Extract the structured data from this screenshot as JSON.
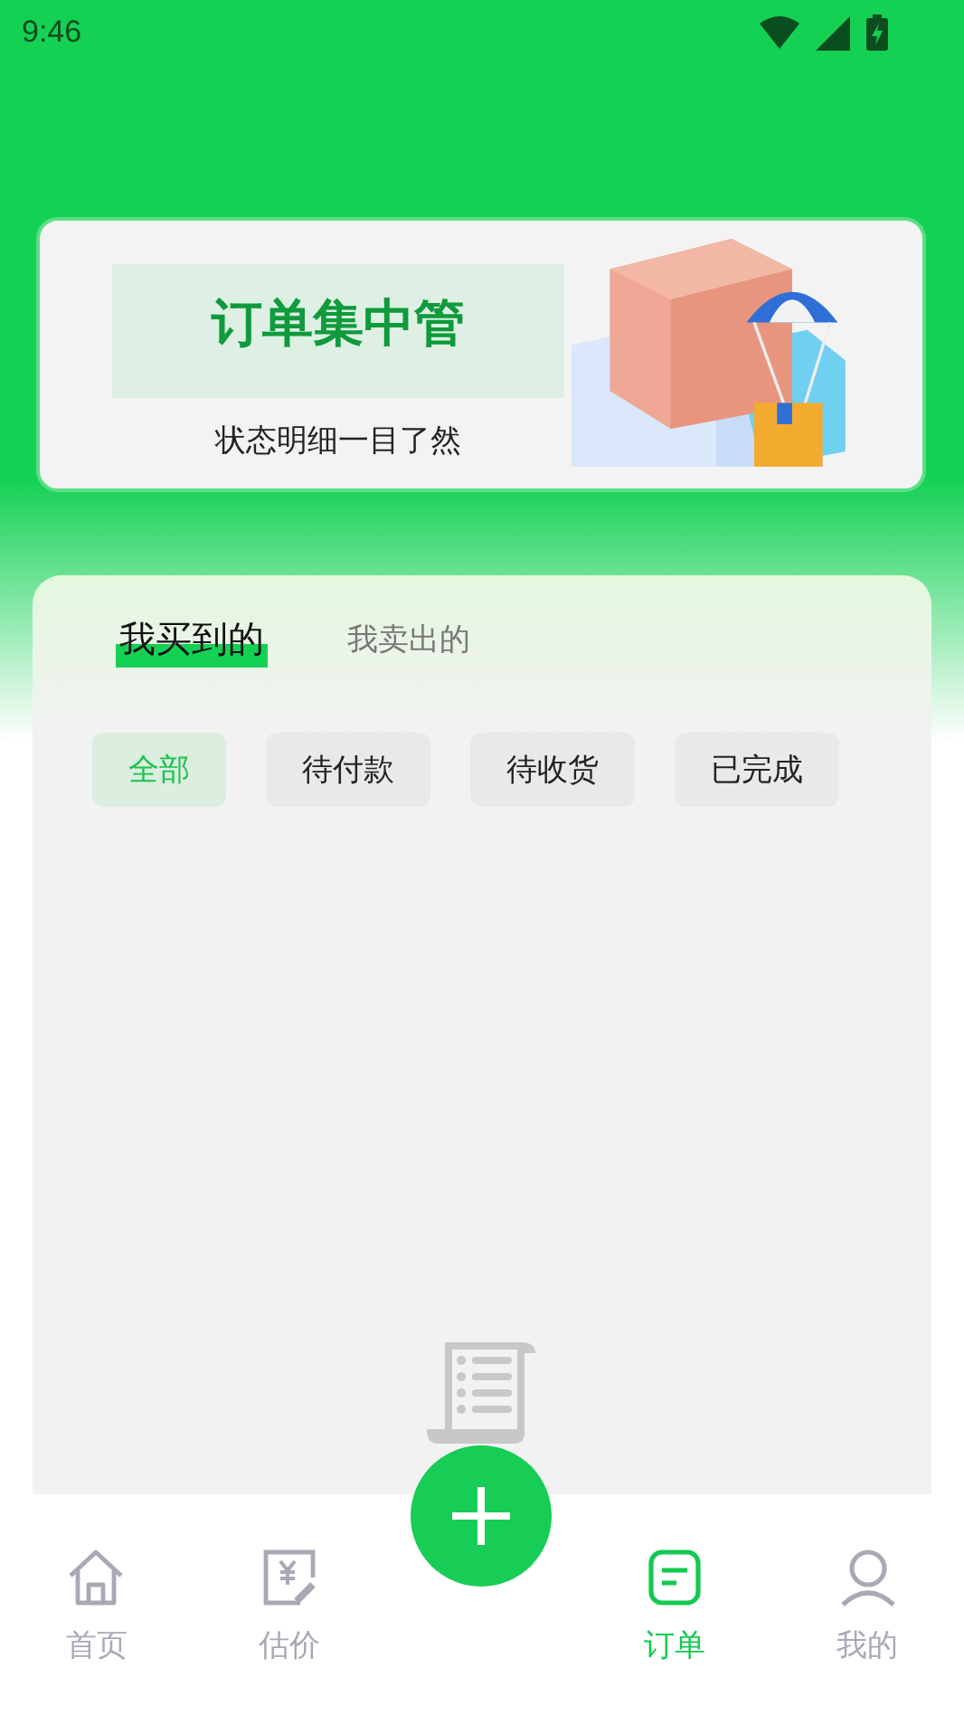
{
  "status_bar": {
    "time": "9:46"
  },
  "banner": {
    "title": "订单集中管",
    "subtitle": "状态明细一目了然"
  },
  "tabs": [
    {
      "label": "我买到的",
      "selected": true
    },
    {
      "label": "我卖出的",
      "selected": false
    }
  ],
  "filters": [
    {
      "label": "全部",
      "selected": true
    },
    {
      "label": "待付款",
      "selected": false
    },
    {
      "label": "待收货",
      "selected": false
    },
    {
      "label": "已完成",
      "selected": false
    }
  ],
  "bottom_nav": [
    {
      "kind": "home",
      "label": "首页",
      "selected": false
    },
    {
      "kind": "estimate",
      "label": "估价",
      "selected": false
    },
    {
      "kind": "add"
    },
    {
      "kind": "orders",
      "label": "订单",
      "selected": true
    },
    {
      "kind": "profile",
      "label": "我的",
      "selected": false
    }
  ]
}
